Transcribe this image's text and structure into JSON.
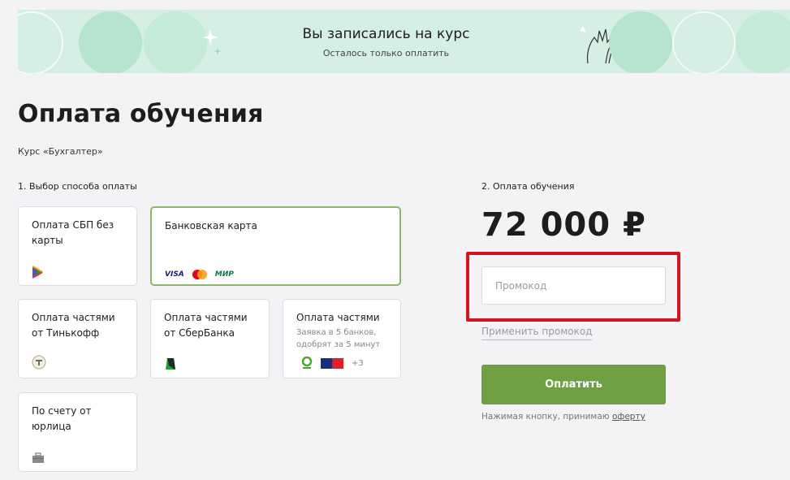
{
  "banner": {
    "title": "Вы записались на курс",
    "subtitle": "Осталось только оплатить"
  },
  "page": {
    "title": "Оплата обучения",
    "course": "Курс «Бухгалтер»"
  },
  "payment_methods": {
    "section_label": "1. Выбор способа оплаты",
    "options": [
      {
        "title": "Оплата СБП без карты",
        "icon": "sbp-icon",
        "selected": false
      },
      {
        "title": "Банковская карта",
        "icon": "card-brands-icon",
        "brands": [
          "VISA",
          "МИР"
        ],
        "selected": true
      },
      {
        "title": "Оплата частями от Тинькофф",
        "icon": "tinkoff-icon",
        "selected": false
      },
      {
        "title": "Оплата частями от СберБанка",
        "icon": "sber-icon",
        "selected": false
      },
      {
        "title": "Оплата частями",
        "subtitle": "Заявка в 5 банков, одобрят за 5 минут",
        "icon": "banks-icon",
        "extra": "+3",
        "selected": false
      },
      {
        "title": "По счету от юрлица",
        "icon": "briefcase-icon",
        "selected": false
      }
    ]
  },
  "checkout": {
    "section_label": "2. Оплата обучения",
    "price": "72 000 ₽",
    "promo_placeholder": "Промокод",
    "apply_label": "Применить промокод",
    "pay_label": "Оплатить",
    "offer_prefix": "Нажимая кнопку, принимаю ",
    "offer_link": "оферту"
  },
  "colors": {
    "banner_bg": "#d5efe4",
    "accent_green": "#6ea144",
    "selected_border": "#8db36c",
    "highlight_red": "#d3151d"
  }
}
